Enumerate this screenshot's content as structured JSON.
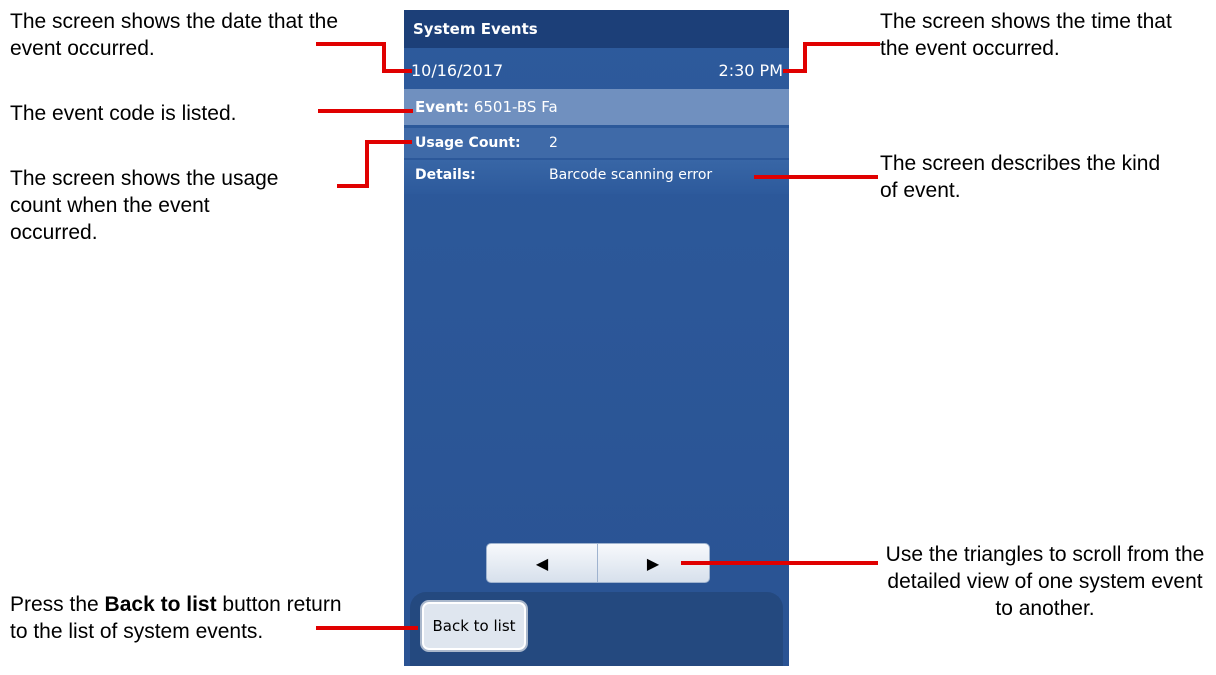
{
  "annotations": {
    "date_note": "The screen shows the date that the event occurred.",
    "event_code_note": "The event code is listed.",
    "usage_note": "The screen shows the usage count when the event occurred.",
    "back_note_pre": "Press the ",
    "back_note_bold": "Back to list",
    "back_note_post": " button return to the list of system events.",
    "time_note": "The screen shows the time that the event occurred.",
    "details_note": "The screen describes the kind of event.",
    "triangles_note": "Use the triangles to scroll from the detailed view of one system event to another."
  },
  "screen": {
    "title": "System Events",
    "date": "10/16/2017",
    "time": "2:30 PM",
    "event_label": "Event:",
    "event_value": "6501-BS Fa",
    "usage_label": "Usage Count:",
    "usage_value": "2",
    "details_label": "Details:",
    "details_value": "Barcode scanning error",
    "prev_icon": "triangle-left-icon",
    "next_icon": "triangle-right-icon",
    "prev_glyph": "◀",
    "next_glyph": "▶",
    "back_button": "Back to list"
  },
  "colors": {
    "callout_line": "#e00000",
    "title_bar": "#1c3f78",
    "screen_bg": "#2d5a9c",
    "event_row": "#7090bf"
  }
}
